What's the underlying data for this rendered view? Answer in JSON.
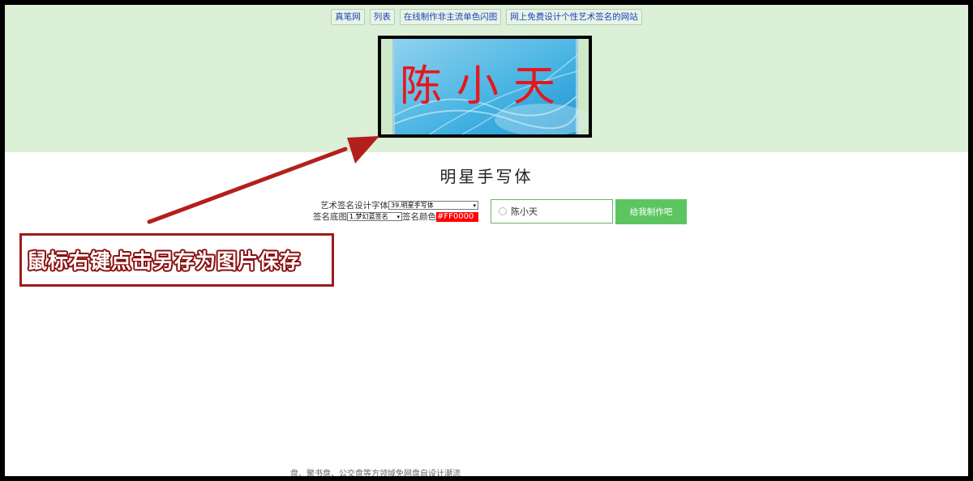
{
  "nav": {
    "items": [
      {
        "label": "真笔网"
      },
      {
        "label": "列表"
      },
      {
        "label": "在线制作非主流单色闪图"
      },
      {
        "label": "网上免费设计个性艺术签名的网站"
      }
    ]
  },
  "preview": {
    "signature_text": "陈小天",
    "signature_color": "#FF0000"
  },
  "font_title": "明星手写体",
  "form": {
    "font_label": "艺术签名设计字体",
    "font_selected": "39.明星手写体",
    "bg_label": "签名底图",
    "bg_selected": "1.梦幻蓝签名",
    "color_label": "签名颜色",
    "color_value": "#FF0000",
    "name_value": "陈小天",
    "submit_label": "给我制作吧"
  },
  "annotation": {
    "callout_text": "鼠标右键点击另存为图片保存",
    "arrow_color": "#b3201c"
  },
  "footer_text": "盘、聚书盘、公交盘等方领域免网盘自设计潮流"
}
